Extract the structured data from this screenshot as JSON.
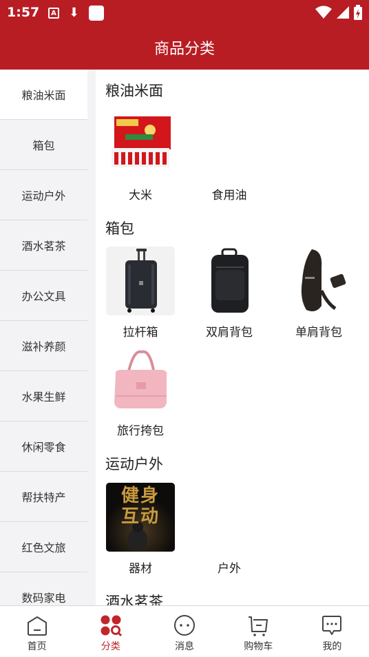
{
  "status": {
    "time": "1:57",
    "a_icon": "A",
    "download_icon": "⬇"
  },
  "header": {
    "title": "商品分类"
  },
  "sidebar": {
    "items": [
      {
        "label": "粮油米面",
        "active": true
      },
      {
        "label": "箱包"
      },
      {
        "label": "运动户外"
      },
      {
        "label": "酒水茗茶"
      },
      {
        "label": "办公文具"
      },
      {
        "label": "滋补养颜"
      },
      {
        "label": "水果生鲜"
      },
      {
        "label": "休闲零食"
      },
      {
        "label": "帮扶特产"
      },
      {
        "label": "红色文旅"
      },
      {
        "label": "数码家电"
      }
    ]
  },
  "sections": [
    {
      "title": "粮油米面",
      "products": [
        {
          "label": "大米",
          "image": "rice-box-image"
        },
        {
          "label": "食用油"
        }
      ]
    },
    {
      "title": "箱包",
      "products": [
        {
          "label": "拉杆箱",
          "image": "suitcase-image"
        },
        {
          "label": "双肩背包",
          "image": "backpack-image"
        },
        {
          "label": "单肩背包",
          "image": "sling-bag-image"
        },
        {
          "label": "旅行挎包",
          "image": "pink-bag-image"
        }
      ]
    },
    {
      "title": "运动户外",
      "products": [
        {
          "label": "器材",
          "image": "fitness-poster-image",
          "poster_text": "健身\n互动"
        },
        {
          "label": "户外"
        }
      ]
    },
    {
      "title": "酒水茗茶"
    }
  ],
  "tabbar": {
    "items": [
      {
        "label": "首页",
        "icon": "home-icon"
      },
      {
        "label": "分类",
        "icon": "category-icon",
        "active": true
      },
      {
        "label": "消息",
        "icon": "message-icon"
      },
      {
        "label": "购物车",
        "icon": "cart-icon"
      },
      {
        "label": "我的",
        "icon": "profile-icon"
      }
    ]
  },
  "colors": {
    "brand_red": "#b81d24",
    "active_tab": "#c0262c",
    "sidebar_bg": "#f3f3f5"
  }
}
